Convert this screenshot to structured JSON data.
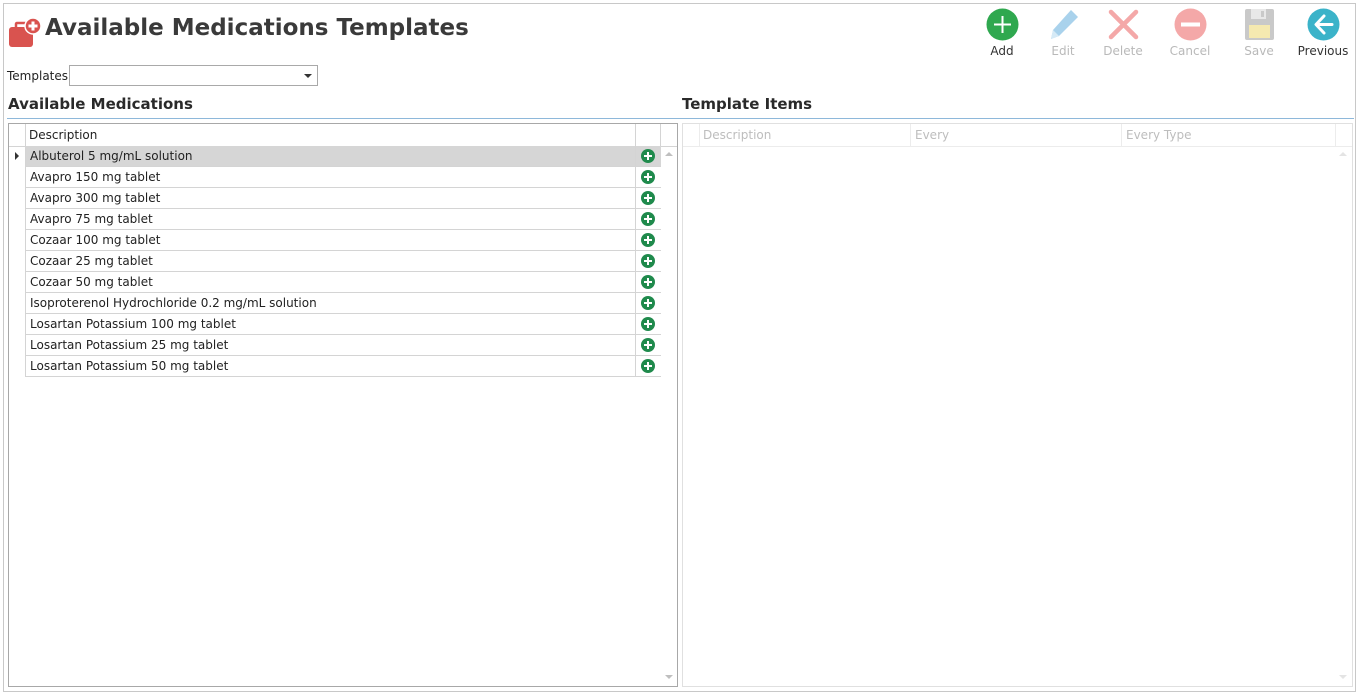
{
  "header": {
    "title": "Available Medications Templates"
  },
  "toolbar": {
    "add_label": "Add",
    "edit_label": "Edit",
    "delete_label": "Delete",
    "cancel_label": "Cancel",
    "save_label": "Save",
    "previous_label": "Previous"
  },
  "templates": {
    "label": "Templates:",
    "selected_value": ""
  },
  "available_medications": {
    "heading": "Available Medications",
    "columns": [
      "Description"
    ],
    "items": [
      {
        "description": "Albuterol 5 mg/mL solution"
      },
      {
        "description": "Avapro 150 mg tablet"
      },
      {
        "description": "Avapro 300 mg tablet"
      },
      {
        "description": "Avapro 75 mg tablet"
      },
      {
        "description": "Cozaar 100 mg tablet"
      },
      {
        "description": "Cozaar 25 mg tablet"
      },
      {
        "description": "Cozaar 50 mg tablet"
      },
      {
        "description": "Isoproterenol Hydrochloride 0.2 mg/mL solution"
      },
      {
        "description": "Losartan Potassium 100 mg tablet"
      },
      {
        "description": "Losartan Potassium 25 mg tablet"
      },
      {
        "description": "Losartan Potassium 50 mg tablet"
      }
    ],
    "selected_index": 0
  },
  "template_items": {
    "heading": "Template Items",
    "columns": [
      "Description",
      "Every",
      "Every Type"
    ]
  },
  "colors": {
    "add_green": "#2fa84f",
    "row_add_green": "#1f8a4c",
    "disabled_red": "#f4a8a8",
    "disabled_blue": "#a9d2ec",
    "previous_teal": "#3bb3c9",
    "title_icon_red": "#d9534f",
    "section_line": "#8eb8da"
  },
  "icons": {
    "title": "medication-case-icon",
    "add": "plus-circle-icon",
    "edit": "pencil-icon",
    "delete": "x-icon",
    "cancel": "minus-circle-icon",
    "save": "floppy-disk-icon",
    "previous": "arrow-left-circle-icon",
    "row_action": "plus-circle-icon"
  }
}
